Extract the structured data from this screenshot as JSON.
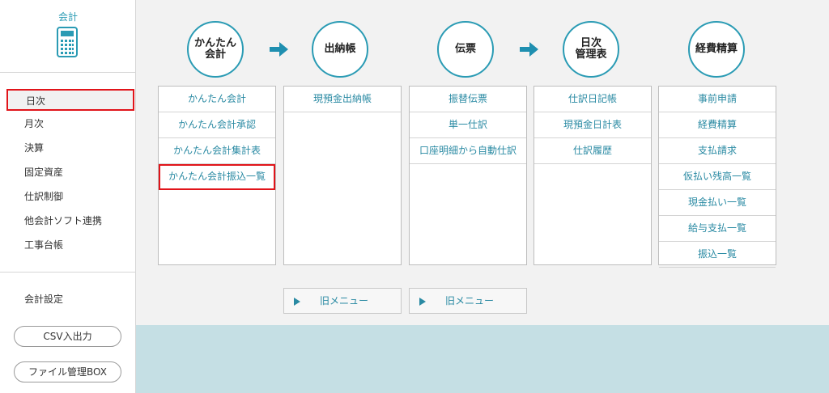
{
  "sidebar": {
    "title": "会計",
    "icon": "calculator-icon",
    "items": [
      {
        "label": "日次",
        "active": true
      },
      {
        "label": "月次"
      },
      {
        "label": "決算"
      },
      {
        "label": "固定資産"
      },
      {
        "label": "仕訳制御"
      },
      {
        "label": "他会計ソフト連携"
      },
      {
        "label": "工事台帳"
      }
    ],
    "settings_label": "会計設定",
    "csv_button": "CSV入出力",
    "file_box_button": "ファイル管理BOX"
  },
  "flow": {
    "steps": [
      {
        "label": "かんたん\n会計"
      },
      {
        "label": "出納帳"
      },
      {
        "label": "伝票"
      },
      {
        "label": "日次\n管理表"
      },
      {
        "label": "経費精算"
      }
    ],
    "arrow_color": "#1f8fb0"
  },
  "columns": [
    {
      "items": [
        "かんたん会計",
        "かんたん会計承認",
        "かんたん会計集計表",
        "かんたん会計振込一覧"
      ],
      "highlighted_index": 3
    },
    {
      "items": [
        "現預金出納帳"
      ]
    },
    {
      "items": [
        "振替伝票",
        "単一仕訳",
        "口座明細から自動仕訳"
      ]
    },
    {
      "items": [
        "仕訳日記帳",
        "現預金日計表",
        "仕訳履歴"
      ]
    },
    {
      "items": [
        "事前申請",
        "経費精算",
        "支払請求",
        "仮払い残高一覧",
        "現金払い一覧",
        "給与支払一覧",
        "振込一覧"
      ]
    }
  ],
  "old_menu": {
    "label": "旧メニュー",
    "icon": "play-triangle-icon"
  },
  "colors": {
    "accent": "#2a9bb4",
    "highlight": "#e1141a",
    "band": "#c5dfe4"
  }
}
